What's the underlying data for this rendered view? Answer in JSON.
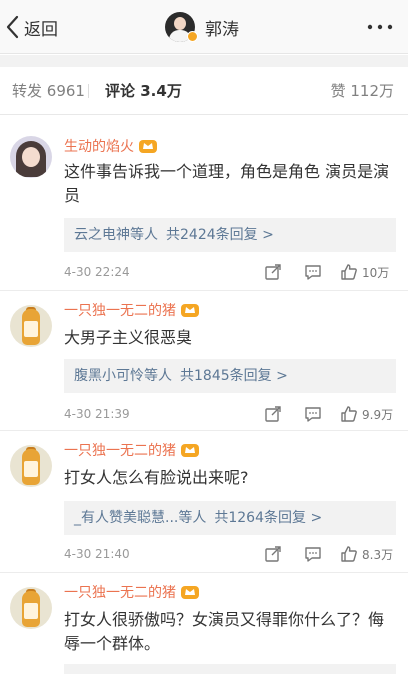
{
  "navbar": {
    "back_label": "返回",
    "title": "郭涛",
    "back_icon": "chevron-left-icon",
    "more_icon": "more-dots-icon"
  },
  "tabs": {
    "repost_label": "转发",
    "repost_count": "6961",
    "comment_label": "评论",
    "comment_count": "3.4万",
    "like_label": "赞",
    "like_count": "112万"
  },
  "comments": [
    {
      "username": "生动的焰火",
      "text": "这件事告诉我一个道理，角色是角色 演员是演员",
      "replies_who": "云之电神等人",
      "replies_count": "共2424条回复 >",
      "time": "4-30 22:24",
      "likes": "10万"
    },
    {
      "username": "一只独一无二的猪",
      "text": "大男子主义很恶臭",
      "replies_who": "腹黑小可怜等人",
      "replies_count": "共1845条回复 >",
      "time": "4-30 21:39",
      "likes": "9.9万"
    },
    {
      "username": "一只独一无二的猪",
      "text": "打女人怎么有脸说出来呢?",
      "replies_who": "_有人赞美聪慧...等人",
      "replies_count": "共1264条回复 >",
      "time": "4-30 21:40",
      "likes": "8.3万"
    },
    {
      "username": "一只独一无二的猪",
      "text": "打女人很骄傲吗？女演员又得罪你什么了？侮辱一个群体。"
    }
  ],
  "colors": {
    "accent_name": "#eb7350",
    "link_blue": "#5d7895",
    "badge_orange": "#f5a623"
  }
}
